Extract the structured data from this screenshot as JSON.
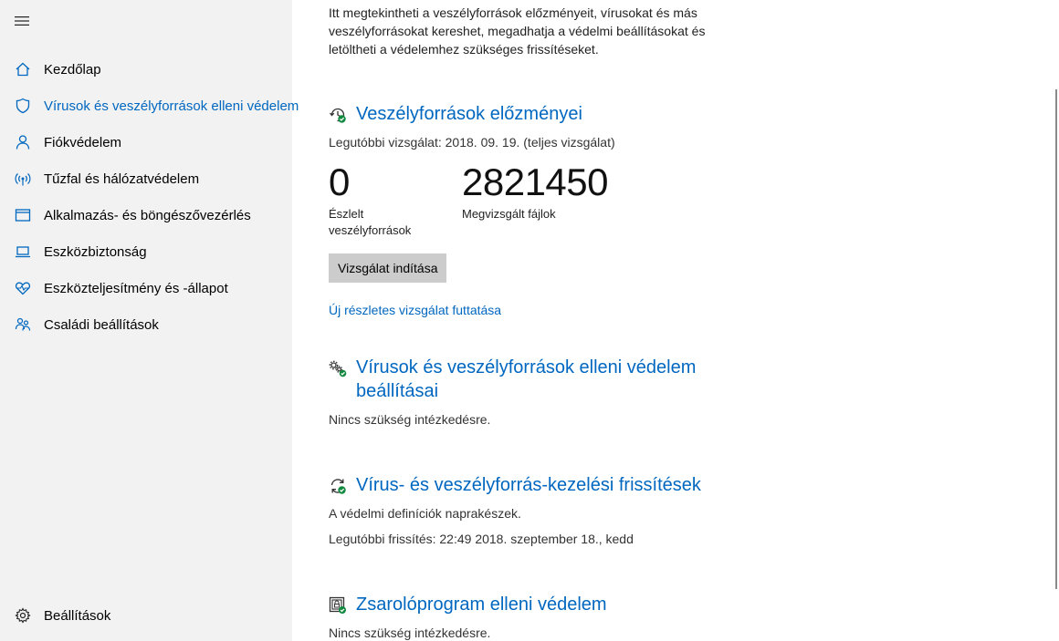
{
  "sidebar": {
    "menu_icon": "hamburger-icon",
    "items": [
      {
        "label": "Kezdőlap",
        "icon": "home-icon"
      },
      {
        "label": "Vírusok és veszélyforrások elleni védelem",
        "icon": "shield-icon",
        "active": true
      },
      {
        "label": "Fiókvédelem",
        "icon": "person-icon"
      },
      {
        "label": "Tűzfal és hálózatvédelem",
        "icon": "wireless-icon"
      },
      {
        "label": "Alkalmazás- és böngészővezérlés",
        "icon": "browser-window-icon"
      },
      {
        "label": "Eszközbiztonság",
        "icon": "laptop-icon"
      },
      {
        "label": "Eszközteljesítmény és -állapot",
        "icon": "heart-icon"
      },
      {
        "label": "Családi beállítások",
        "icon": "family-icon"
      }
    ],
    "settings": {
      "label": "Beállítások",
      "icon": "gear-icon"
    }
  },
  "main": {
    "intro": "Itt megtekintheti a veszélyforrások előzményeit, vírusokat és más veszélyforrásokat kereshet, megadhatja a védelmi beállításokat és letöltheti a védelemhez szükséges frissítéseket.",
    "history": {
      "title": "Veszélyforrások előzményei",
      "last_scan": "Legutóbbi vizsgálat: 2018. 09. 19. (teljes vizsgálat)",
      "threats_value": "0",
      "threats_label": "Észlelt veszélyforrások",
      "files_value": "2821450",
      "files_label": "Megvizsgált fájlok",
      "scan_button": "Vizsgálat indítása",
      "advanced_link": "Új részletes vizsgálat futtatása"
    },
    "settings_section": {
      "title": "Vírusok és veszélyforrások elleni védelem beállításai",
      "status": "Nincs szükség intézkedésre."
    },
    "updates_section": {
      "title": "Vírus- és veszélyforrás-kezelési frissítések",
      "status": "A védelmi definíciók naprakészek.",
      "last_update": "Legutóbbi frissítés: 22:49 2018. szeptember 18., kedd"
    },
    "ransomware_section": {
      "title": "Zsarolóprogram elleni védelem",
      "status": "Nincs szükség intézkedésre."
    }
  },
  "colors": {
    "accent": "#0067c0",
    "sidebar_bg": "#f2f2f2",
    "ok_green": "#10893e"
  }
}
